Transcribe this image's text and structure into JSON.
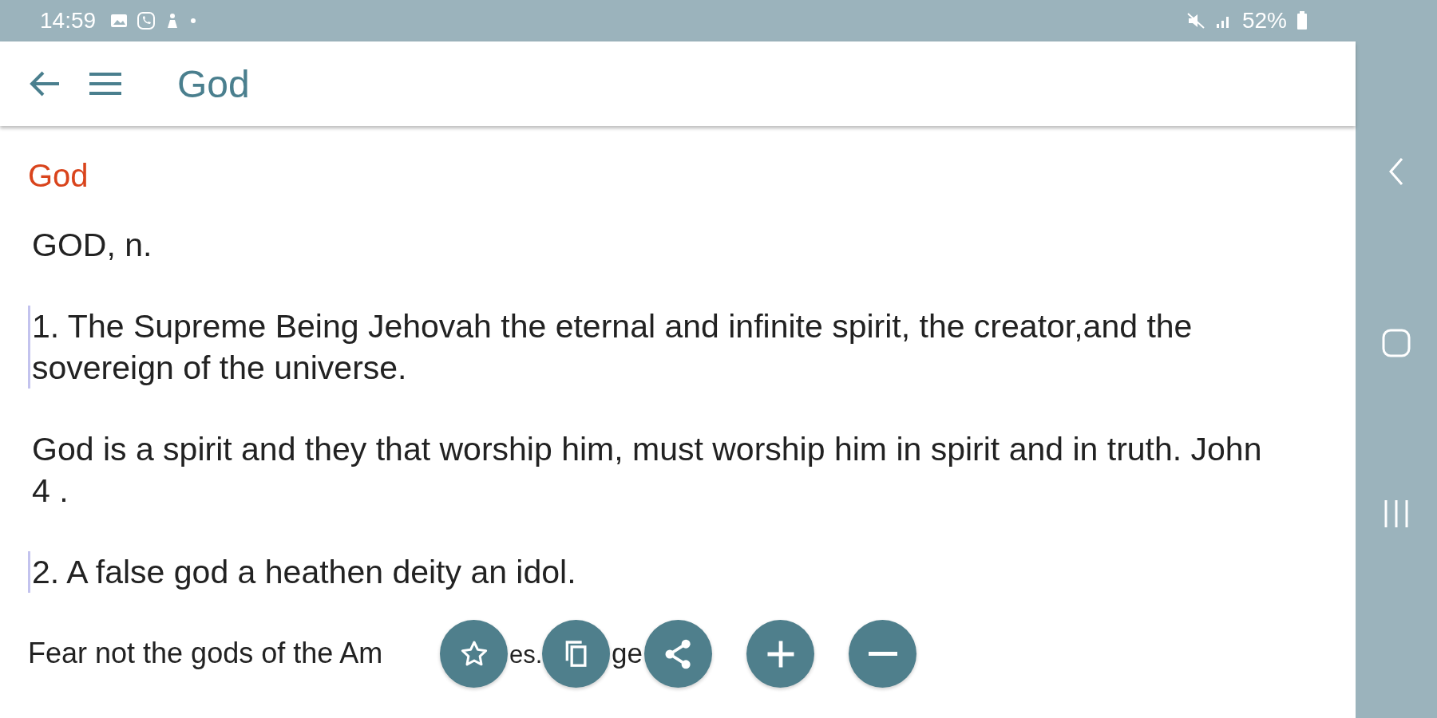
{
  "status_bar": {
    "time": "14:59",
    "battery": "52%"
  },
  "toolbar": {
    "title": "God"
  },
  "entry": {
    "heading": "God",
    "headword": "GOD, n.",
    "paragraphs": [
      {
        "text": "1. The Supreme Being Jehovah the eternal and infinite spirit, the creator,and the sovereign of the universe.",
        "marked": true
      },
      {
        "text": "God is a spirit and they that worship him, must worship him in spirit and in truth. John 4 .",
        "marked": false
      },
      {
        "text": "2. A false god a heathen deity an idol.",
        "marked": true
      }
    ],
    "partial_line": [
      "Fear not the gods of the Am",
      "es.",
      "ge"
    ]
  },
  "actions": [
    {
      "kind": "favorite"
    },
    {
      "kind": "copy"
    },
    {
      "kind": "share"
    },
    {
      "kind": "zoom-in"
    },
    {
      "kind": "zoom-out"
    }
  ]
}
